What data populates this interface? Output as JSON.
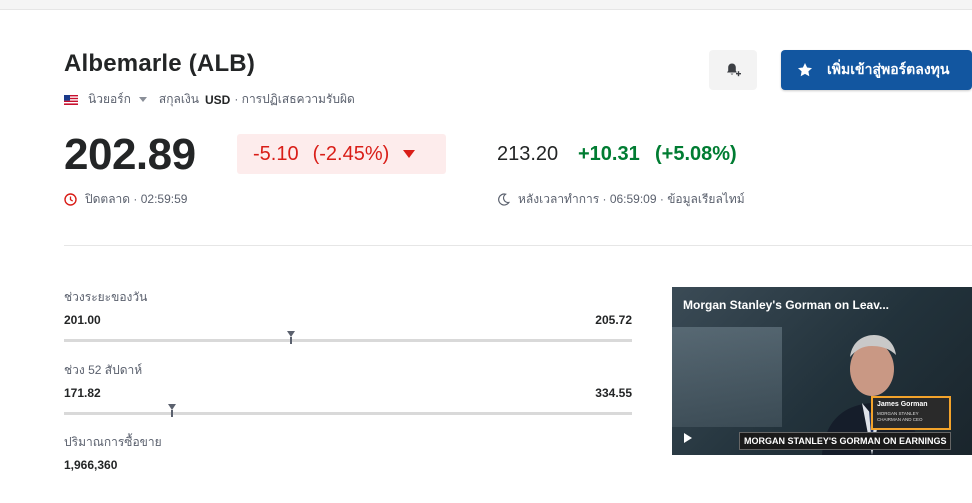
{
  "header": {
    "title": "Albemarle (ALB)",
    "exchange": "นิวยอร์ก",
    "currency_label": "สกุลเงิน",
    "currency": "USD",
    "disclaimer": "· การปฏิเสธความรับผิด"
  },
  "actions": {
    "watchlist_label": "เพิ่มเข้าสู่พอร์ตลงทุน",
    "bell_icon": "bell-plus-icon",
    "star_icon": "star-icon"
  },
  "quote": {
    "price": "202.89",
    "change": "-5.10",
    "change_pct": "(-2.45%)",
    "status": "ปิดตลาด · 02:59:59",
    "afterhours_price": "213.20",
    "afterhours_change": "+10.31",
    "afterhours_pct": "(+5.08%)",
    "afterhours_status": "หลังเวลาทำการ · 06:59:09 · ข้อมูลเรียลไทม์"
  },
  "colors": {
    "negative": "#d91e18",
    "positive": "#007c32",
    "brand_blue": "#1256a0"
  },
  "ranges": {
    "day": {
      "label": "ช่วงระยะของวัน",
      "low": "201.00",
      "high": "205.72",
      "position_pct": 40
    },
    "week52": {
      "label": "ช่วง 52 สัปดาห์",
      "low": "171.82",
      "high": "334.55",
      "position_pct": 19
    }
  },
  "volume": {
    "label": "ปริมาณการซื้อขาย",
    "value": "1,966,360"
  },
  "video": {
    "title": "Morgan Stanley's Gorman on Leav...",
    "person_name": "James Gorman",
    "person_role1": "MORGAN STANLEY",
    "person_role2": "CHAIRMAN AND CEO",
    "caption": "MORGAN STANLEY'S GORMAN ON EARNINGS"
  }
}
